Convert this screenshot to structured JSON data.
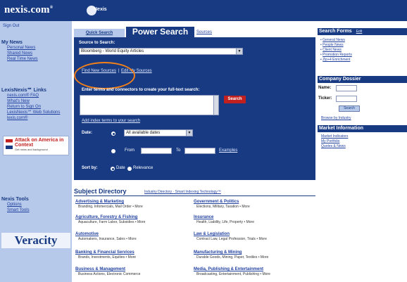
{
  "header": {
    "logo_text": "nexis.com",
    "logo_mark": "®",
    "badge_text": "Nexis"
  },
  "sidebar": {
    "top_link": "Sign Out",
    "news_heading": "My News",
    "news_items": [
      "Personal News",
      "Shared News",
      "Real Time News"
    ],
    "links_heading": "LexisNexis℠ Links",
    "link_items": [
      "nexis.com® FAQ",
      "What's New",
      "Return to Sign On",
      "LexisNexis℠ Web Solutions",
      "lexis.com®"
    ],
    "ad_title": "Attack on America in Context",
    "ad_sub": "Get news and background",
    "tools_heading": "Nexis Tools",
    "tool_items": [
      "Options",
      "Smart Tools"
    ],
    "veracity_logo": "Veracity"
  },
  "search": {
    "tab_quick": "Quick Search",
    "tab_power": "Power Search",
    "tab_sources": "Sources",
    "source_label": "Source to Search:",
    "source_value": "Bloomberg - World Equity Articles",
    "find_link": "Find New Sources",
    "edit_link": "Edit My Sources",
    "terms_label": "Enter terms and connectors to create your full-text search:",
    "search_button": "Search",
    "add_index_link": "Add index terms to your search",
    "date_label": "Date:",
    "date_value": "All available dates",
    "from_label": "From",
    "to_label": "To",
    "examples_link": "Examples",
    "sort_label": "Sort by:",
    "sort_date": "Date",
    "sort_relevance": "Relevance"
  },
  "subject_directory": {
    "title": "Subject Directory",
    "extra": "Industry Directory · Smart Indexing Technology™",
    "left": [
      {
        "title": "Advertising & Marketing",
        "desc": "Branding, Infomercials, Mail Order • More"
      },
      {
        "title": "Agriculture, Forestry & Fishing",
        "desc": "Aquaculture, Farm Labor, Subsidies • More"
      },
      {
        "title": "Automotive",
        "desc": "Automakers, Insurance, Sales • More"
      },
      {
        "title": "Banking & Financial Services",
        "desc": "Brands, Investments, Equities • More"
      },
      {
        "title": "Business & Management",
        "desc": "Business Actions, Electronic Commerce"
      }
    ],
    "right": [
      {
        "title": "Government & Politics",
        "desc": "Elections, Military, Taxation • More"
      },
      {
        "title": "Insurance",
        "desc": "Health, Liability, Life, Property • More"
      },
      {
        "title": "Law & Legislation",
        "desc": "Contract Law, Legal Profession, Trials • More"
      },
      {
        "title": "Manufacturing & Mining",
        "desc": "Durable Goods, Mining, Paper, Textiles • More"
      },
      {
        "title": "Media, Publishing & Entertainment",
        "desc": "Broadcasting, Entertainment, Publishing • More"
      }
    ]
  },
  "right_panel": {
    "forms_heading": "Search Forms",
    "forms_edit": "Edit",
    "forms_items": [
      "General News",
      "People News",
      "Client News",
      "Promotion Reports",
      "Zip+4 Enrichment"
    ],
    "dossier_heading": "Company Dossier",
    "name_label": "Name:",
    "ticker_label": "Ticker:",
    "go_button": "Search",
    "browse_link": "Browse by Industry",
    "market_heading": "Market Information",
    "market_items": [
      "Market Indicators",
      "My Portfolio",
      "Quotes & News"
    ]
  }
}
